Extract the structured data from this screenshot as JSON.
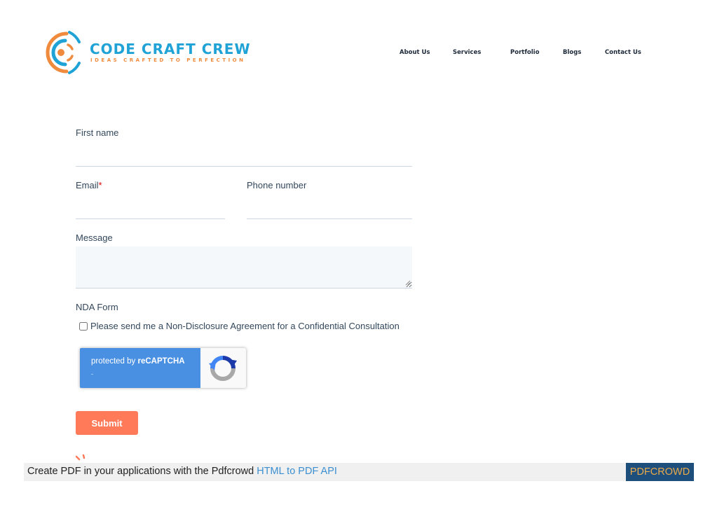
{
  "brand": {
    "name": "CODE CRAFT CREW",
    "tagline": "IDEAS CRAFTED TO PERFECTION",
    "colors": {
      "primary": "#1fa2d6",
      "accent": "#f08a3c"
    }
  },
  "nav": {
    "items": [
      {
        "label": "About Us"
      },
      {
        "label": "Services"
      },
      {
        "label": "Portfolio"
      },
      {
        "label": "Blogs"
      },
      {
        "label": "Contact Us"
      }
    ]
  },
  "form": {
    "first_name": {
      "label": "First name",
      "value": ""
    },
    "email": {
      "label": "Email",
      "required_mark": "*",
      "value": ""
    },
    "phone": {
      "label": "Phone number",
      "value": ""
    },
    "message": {
      "label": "Message",
      "value": ""
    },
    "nda": {
      "label": "NDA Form",
      "checkbox_label": "Please send me a Non-Disclosure Agreement for a Confidential Consultation",
      "checked": false
    },
    "recaptcha": {
      "prefix": "protected by ",
      "brand": "reCAPTCHA",
      "sub": "-"
    },
    "submit_label": "Submit",
    "submit_color": "#ff7a59"
  },
  "pdfcrowd": {
    "text": "Create PDF in your applications with the Pdfcrowd ",
    "link": "HTML to PDF API",
    "brand": "PDFCROWD"
  }
}
